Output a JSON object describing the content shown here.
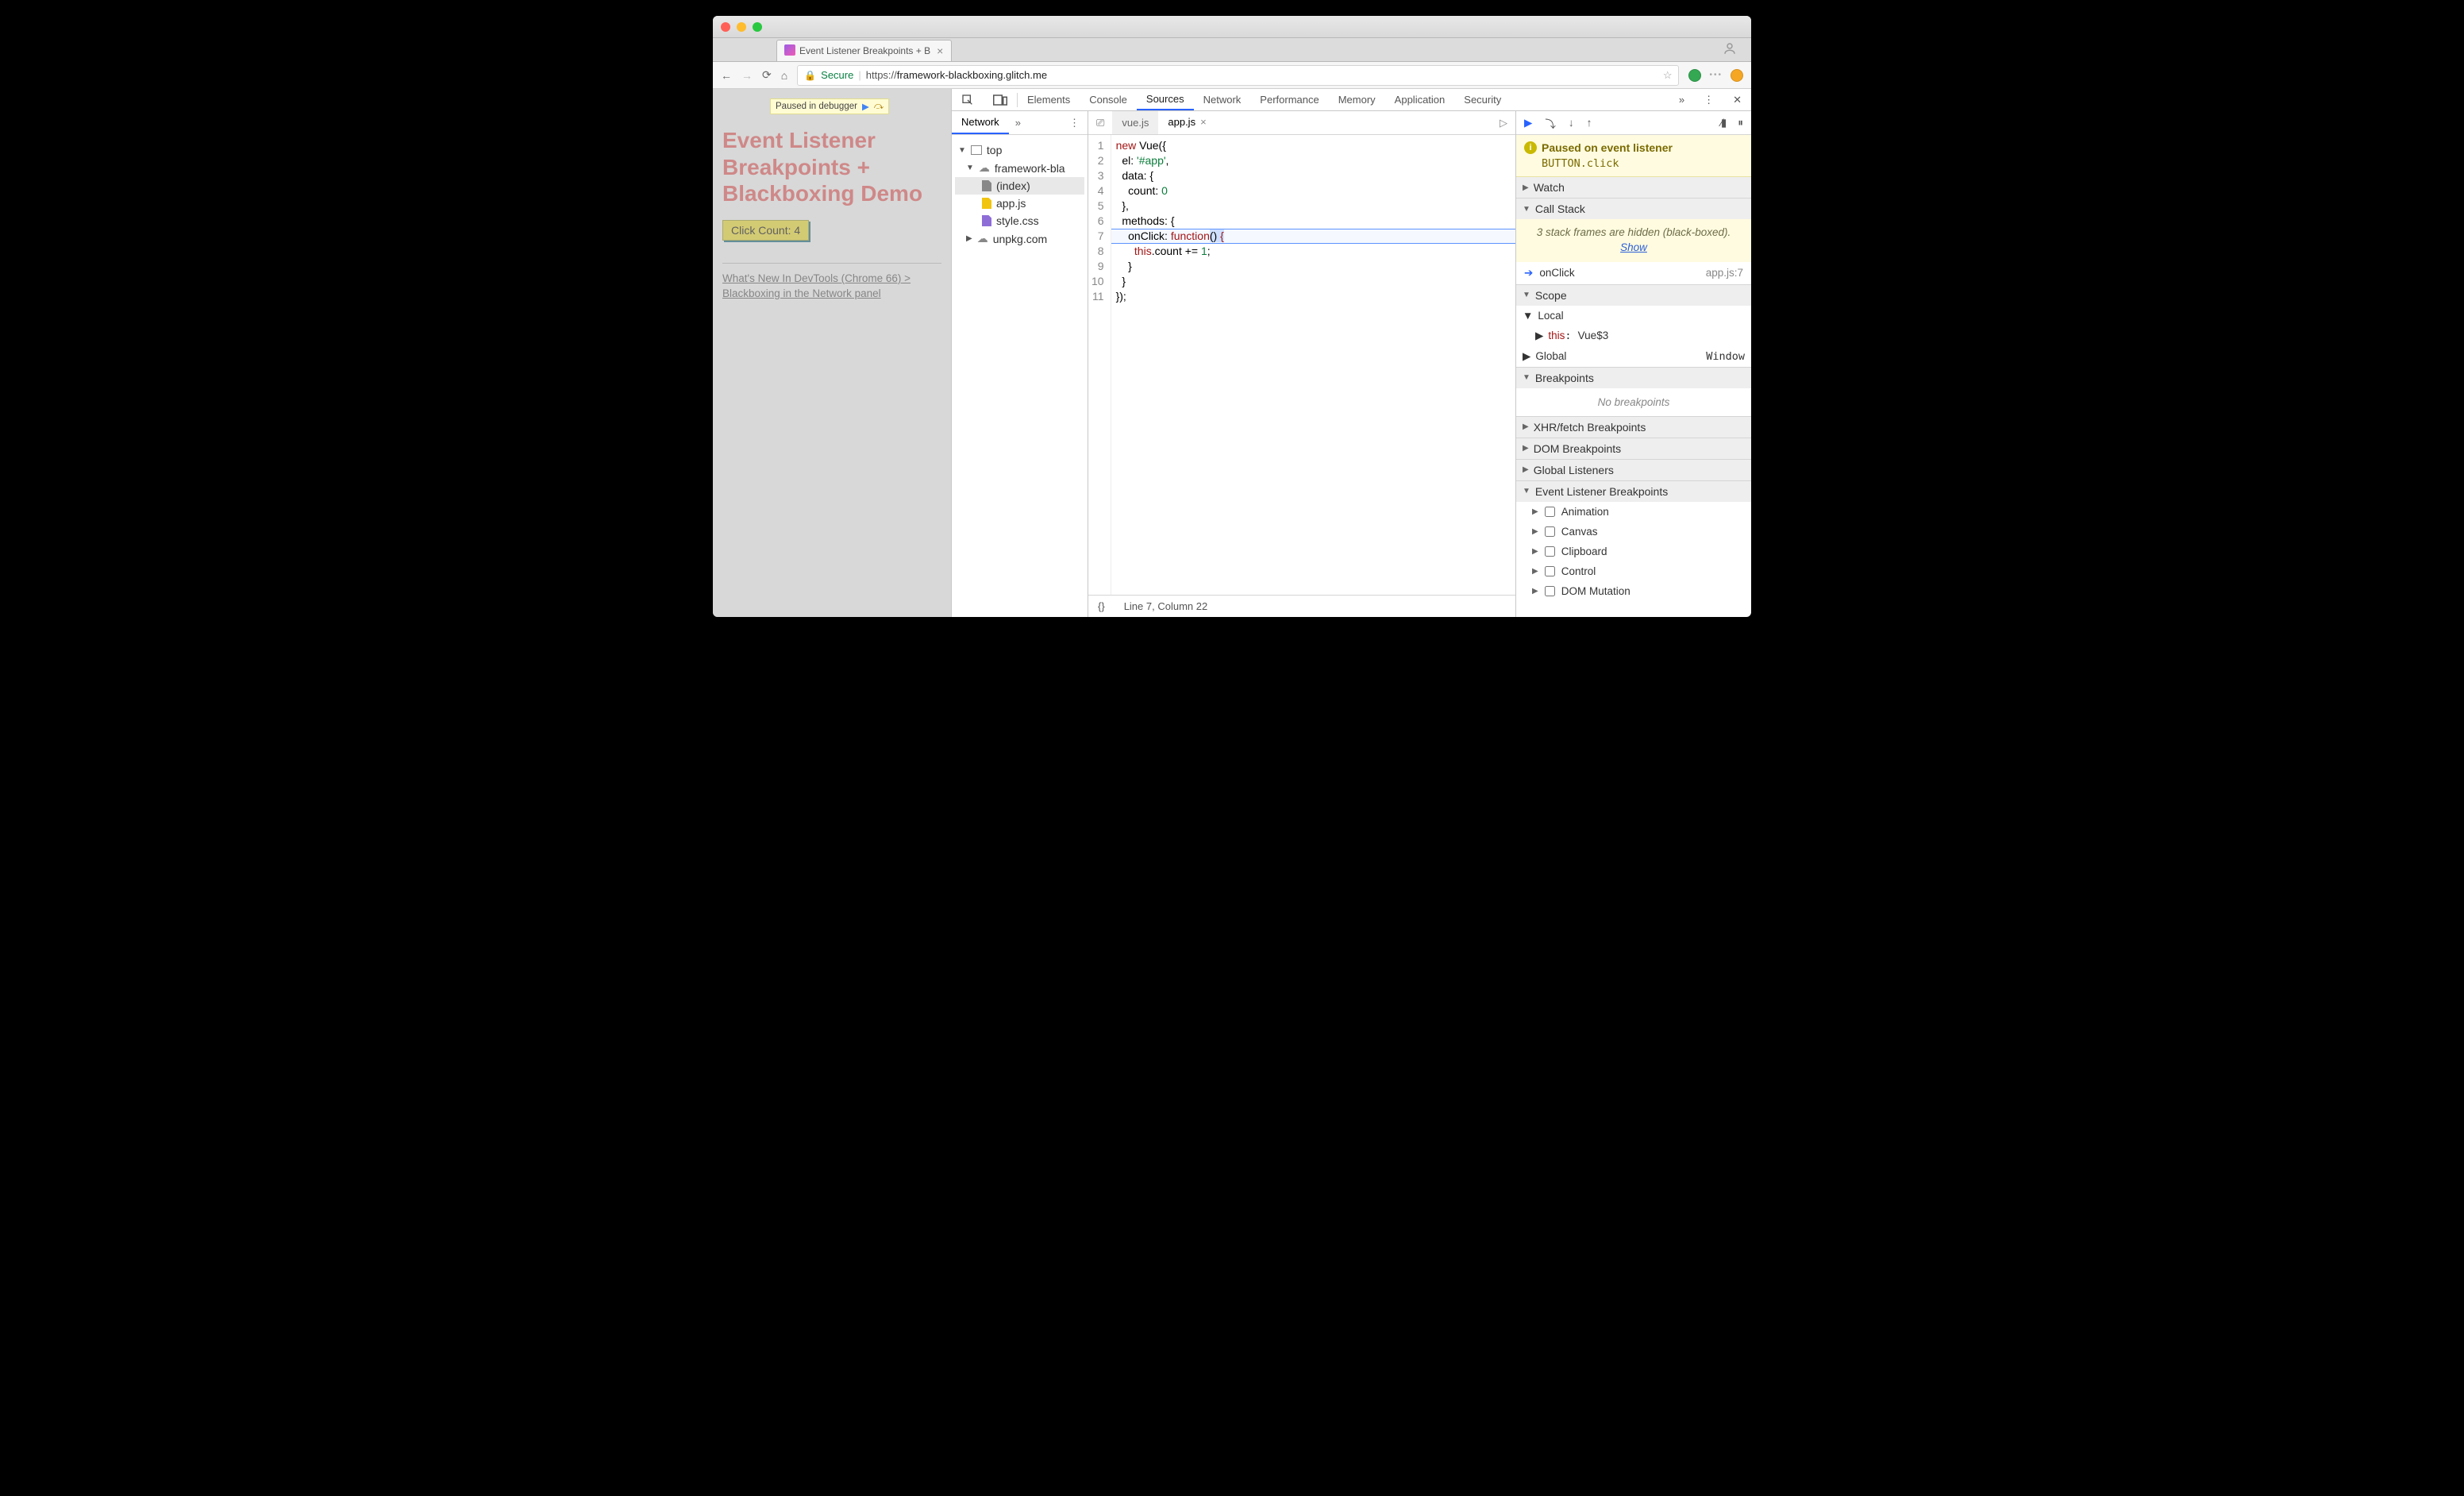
{
  "browser": {
    "tab_title": "Event Listener Breakpoints + B",
    "secure_label": "Secure",
    "url_scheme": "https://",
    "url_host": "framework-blackboxing.glitch.me"
  },
  "page": {
    "paused_label": "Paused in debugger",
    "heading": "Event Listener Breakpoints + Blackboxing Demo",
    "button_label": "Click Count: 4",
    "link_text": "What's New In DevTools (Chrome 66) > Blackboxing in the Network panel"
  },
  "devtools": {
    "tabs": [
      "Elements",
      "Console",
      "Sources",
      "Network",
      "Performance",
      "Memory",
      "Application",
      "Security"
    ],
    "active_tab": "Sources",
    "navigator": {
      "tab": "Network",
      "top": "top",
      "domain1": "framework-bla",
      "files": [
        "(index)",
        "app.js",
        "style.css"
      ],
      "domain2": "unpkg.com"
    },
    "files_open": {
      "inactive": "vue.js",
      "active": "app.js"
    },
    "code_lines": [
      "new Vue({",
      "  el: '#app',",
      "  data: {",
      "    count: 0",
      "  },",
      "  methods: {",
      "    onClick: function() {",
      "      this.count += 1;",
      "    }",
      "  }",
      "});"
    ],
    "cursor": "Line 7, Column 22",
    "paused_banner_title": "Paused on event listener",
    "paused_banner_sub": "BUTTON.click",
    "panels": {
      "watch": "Watch",
      "callstack": "Call Stack",
      "blackbox_msg": "3 stack frames are hidden (black-boxed).  ",
      "blackbox_show": "Show",
      "frame_name": "onClick",
      "frame_loc": "app.js:7",
      "scope": "Scope",
      "local": "Local",
      "this_label": "this",
      "this_val": "Vue$3",
      "global": "Global",
      "global_val": "Window",
      "breakpoints": "Breakpoints",
      "no_bp": "No breakpoints",
      "xhr": "XHR/fetch Breakpoints",
      "dom": "DOM Breakpoints",
      "listeners": "Global Listeners",
      "elb": "Event Listener Breakpoints",
      "elb_items": [
        "Animation",
        "Canvas",
        "Clipboard",
        "Control",
        "DOM Mutation"
      ]
    }
  }
}
